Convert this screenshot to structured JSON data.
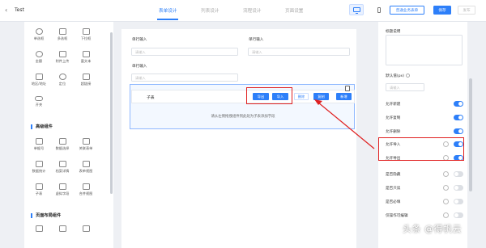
{
  "app": {
    "back_glyph": "‹",
    "title": "Test"
  },
  "tabs": [
    "表单设计",
    "列表设计",
    "流程设计",
    "页面设置"
  ],
  "devices": {
    "desktop": "monitor-icon",
    "mobile": "phone-icon"
  },
  "toolbar": {
    "save_sub": "普通业务表单",
    "save": "保存",
    "publish": "发布"
  },
  "left_panel": {
    "basic_items": [
      "单选框",
      "多选框",
      "下拉框",
      "金额",
      "附件上传",
      "富文本",
      "地区/地址",
      "定位",
      "超链接",
      "开关"
    ],
    "advanced_title": "高级组件",
    "advanced_items": [
      "单据号",
      "数据选择",
      "关联表单",
      "数据统计",
      "档案详情",
      "表单视图",
      "子表",
      "虚拟字段",
      "合并视图"
    ],
    "layout_title": "页面布局组件"
  },
  "form": {
    "field1": {
      "label": "单行输入",
      "placeholder": "请输入"
    },
    "field2": {
      "label": "单行输入",
      "placeholder": "请输入"
    },
    "field3": {
      "label": "单行输入",
      "placeholder": "请输入"
    },
    "subform": {
      "name": "子表",
      "buttons": [
        "导出",
        "导入",
        "删除",
        "复制",
        "新增"
      ],
      "hint": "请从左侧拖拽组件到此处为子表添加字段"
    }
  },
  "right_panel": {
    "title_label": "标题说明",
    "width_label": "默认值(px)",
    "width_placeholder": "请输入",
    "toggles": [
      {
        "label": "允许新建",
        "on": true,
        "gear": false
      },
      {
        "label": "允许复制",
        "on": true,
        "gear": false
      },
      {
        "label": "允许删除",
        "on": true,
        "gear": false
      },
      {
        "label": "允许导入",
        "on": true,
        "gear": true
      },
      {
        "label": "允许导出",
        "on": true,
        "gear": true
      },
      {
        "label": "是否隐藏",
        "on": false,
        "gear": true
      },
      {
        "label": "是否只读",
        "on": false,
        "gear": true
      },
      {
        "label": "是否必填",
        "on": false,
        "gear": true
      },
      {
        "label": "仅操作可编辑",
        "on": false,
        "gear": true
      }
    ]
  },
  "colors": {
    "accent": "#2d7ff9",
    "highlight": "#e02020"
  },
  "watermark": "头条 @得帆云"
}
